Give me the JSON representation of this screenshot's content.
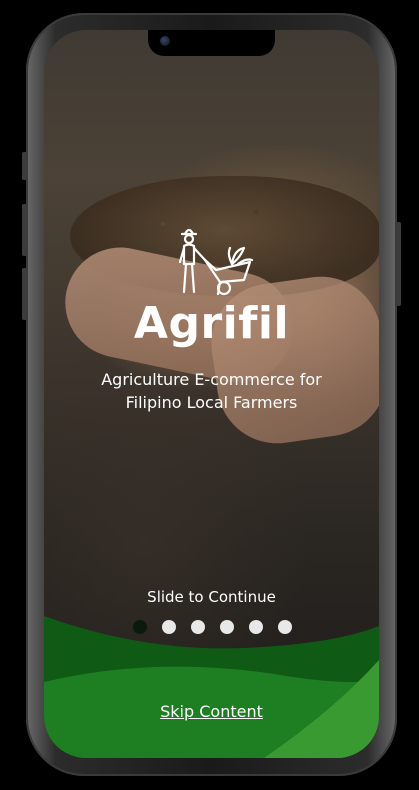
{
  "app": {
    "title": "Agrifil",
    "subtitle_line1": "Agriculture E-commerce for",
    "subtitle_line2": "Filipino Local Farmers",
    "logo_icon": "farmer-wheelbarrow-icon"
  },
  "onboarding": {
    "slide_hint": "Slide to Continue",
    "total_slides": 6,
    "active_slide": 1,
    "skip_label": "Skip Content"
  },
  "colors": {
    "wave_dark": "#0f5a14",
    "wave_mid": "#1d7f22",
    "wave_light": "#3a9a32",
    "dot_active": "#0b1a0b",
    "dot_inactive": "#e8e8e8",
    "text": "#ffffff"
  }
}
